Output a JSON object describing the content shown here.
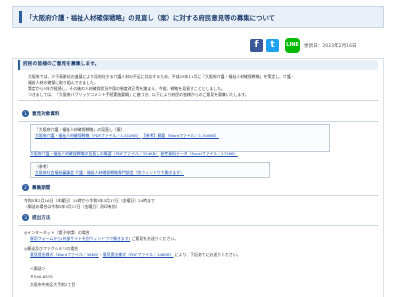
{
  "page": {
    "title": "「大阪府介護・福祉人材確保戦略」の見直し（案）に対する府民意見等の募集について",
    "updated": "更新日：2023年2月16日"
  },
  "share": {
    "facebook": "f",
    "twitter": "t",
    "line": "LINE"
  },
  "intro": {
    "heading": "府民の皆様のご意見を募集します。",
    "body1": "大阪府では、少子高齢化の進展により深刻化する介護人材の不足に対応するため、平成29年11月に「大阪府介護・福祉人材確保戦略」を策定し、介護・",
    "body2": "福祉人材の確保に取り組んできました。",
    "body3": "策定から5年が経過し、その後の人材確保状況や国の制度改正等を踏まえ、今般、戦略を見直すこととしました。",
    "body4": "つきましては、「大阪府パブリックコメント手続実施要綱」に基づき、以下により府民の皆様からのご意見を募集いたします。"
  },
  "section1": {
    "num": "1",
    "label": "意見対象資料",
    "box_title": "「大阪府介護・福祉人材確保戦略」の見直し（案）",
    "link1": "大阪府介護・福祉人材確保戦略（PDFファイル／1,510KB）",
    "link2": "【参考】概要（Wordファイル／1,316KB）",
    "link3": "大阪府介護・福祉人材確保戦略の見直しの概要（PDFファイル／324KB）",
    "link4": "参考資料データ（Excelファイル／275KB）",
    "ref_label": "（参考）",
    "ref_link": "大阪府社会福祉審議会 介護・福祉人材確保戦略専門部会（別ウィンドウで開きます）"
  },
  "section2": {
    "num": "2",
    "label": "募集期間",
    "text1": "令和5年2月16日（木曜日）14時から令和5年3月17日（金曜日）24時まで",
    "text2": "（郵送の場合は令和5年3月17日（金曜日）消印有効）"
  },
  "section3": {
    "num": "3",
    "label": "提出方法",
    "item1": "◎インターネット（電子申請）の場合",
    "item1_link": "専用フォームから(外部サイトを別ウィンドウで開きます)",
    "item1_tail": "ご意見をお送りください。",
    "item2": "◎郵送及びファクシミリの場合",
    "item2_link1": "意見提出様式（Wordファイル／36KB）",
    "item2_link2": "意見提出様式（PDFファイル／106KB）",
    "item2_tail": "により、下記あてにお送りください。",
    "mail_label": "＜郵送＞",
    "zip": "〒540-8570",
    "addr": "大阪市中央区大手前2丁目"
  }
}
